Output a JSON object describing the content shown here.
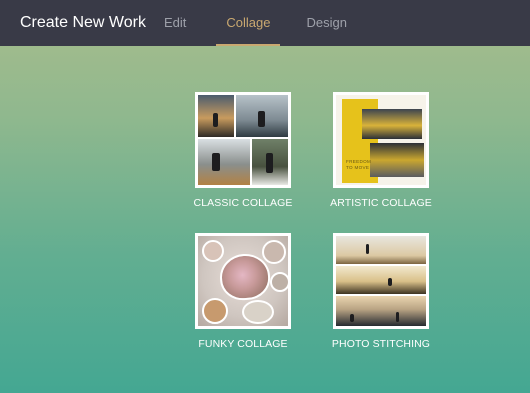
{
  "header": {
    "title": "Create New Work",
    "tabs": [
      {
        "label": "Edit",
        "active": false
      },
      {
        "label": "Collage",
        "active": true
      },
      {
        "label": "Design",
        "active": false
      }
    ]
  },
  "cards": [
    {
      "label": "CLASSIC COLLAGE"
    },
    {
      "label": "ARTISTIC COLLAGE",
      "thumb_text": "FREEDOM TO MOVE"
    },
    {
      "label": "FUNKY COLLAGE"
    },
    {
      "label": "PHOTO STITCHING"
    }
  ],
  "colors": {
    "topbar": "#393a47",
    "active_tab": "#c9a870",
    "inactive_tab": "#9ea1aa",
    "background_top": "#a9bd8c",
    "background_bottom": "#44a792",
    "artistic_yellow": "#e6c21b"
  }
}
